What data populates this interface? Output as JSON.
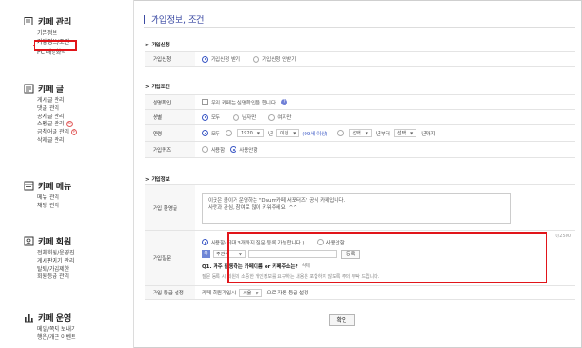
{
  "sidebar": {
    "sections": [
      {
        "title": "카페 관리",
        "icon": "document-icon",
        "items": [
          {
            "label": "기본정보"
          },
          {
            "label": "가입정보/조건",
            "active": true
          },
          {
            "label": "PC 배경화막"
          }
        ]
      },
      {
        "title": "카페 글",
        "icon": "list-icon",
        "items": [
          {
            "label": "게시글 관리"
          },
          {
            "label": "댓글 관리"
          },
          {
            "label": "공지글 관리"
          },
          {
            "label": "스팸글 관리",
            "badge": "N"
          },
          {
            "label": "금칙어글 관리",
            "badge": "N"
          },
          {
            "label": "삭제글 관리"
          }
        ]
      },
      {
        "title": "카페 메뉴",
        "icon": "menu-icon",
        "items": [
          {
            "label": "메뉴 관리"
          },
          {
            "label": "채팅 관리"
          }
        ]
      },
      {
        "title": "카페 회원",
        "icon": "members-icon",
        "items": [
          {
            "label": "전체회원/운영진"
          },
          {
            "label": "게시판지기 관리"
          },
          {
            "label": "탈퇴/가입제한"
          },
          {
            "label": "회원등급 관리"
          }
        ]
      },
      {
        "title": "카페 운영",
        "icon": "chart-icon",
        "items": [
          {
            "label": "메일/쪽지 보내기"
          },
          {
            "label": "행운/개근 이벤트"
          }
        ]
      }
    ]
  },
  "main": {
    "title": "가입정보, 조건",
    "group_join_method": {
      "title": "가입신청",
      "row_label": "가입신청",
      "options": [
        "가입신청 받기",
        "가입신청 안받기"
      ]
    },
    "group_join_condition": {
      "title": "가입조건",
      "verify_label": "실명확인",
      "verify_text": "우리 카페는 실명확인을 합니다.",
      "gender_label": "성별",
      "gender_options": [
        "모두",
        "남자만",
        "여자만"
      ],
      "age_label": "연령",
      "age_all": "모두",
      "age_year": "1920",
      "age_year_unit": "년",
      "age_before": "이전",
      "age_note": "(99세 이상)",
      "age_select1": "선택",
      "age_from": "년부터",
      "age_select2": "선택",
      "age_to": "년까지",
      "quiz_label": "가입퀴즈",
      "quiz_options": [
        "사용함",
        "사용안함"
      ]
    },
    "group_join_info": {
      "title": "가입정보",
      "greeting_label": "가입 환영글",
      "greeting_text_line1": "이곳은 콤이가 운영하는 \"Daum카페 서포터즈\" 공식 카페입니다.",
      "greeting_text_line2": "사랑과 관심, 참여로 많이 키워주세요! ^^",
      "greeting_counter": "0/2500",
      "question_label": "가입질문",
      "question_use": "사용함(최대 3개까지 질문 등록 가능합니다.)",
      "question_nouse": "사용안함",
      "question_type_tag": "Q",
      "question_type": "주관식",
      "register_button": "등록",
      "question_text": "Q1. 자주 활동하는 카페이름 or 카페주소는?",
      "question_delete": "삭제",
      "question_warning": "질문 등록 시 회원의 소중한 개인정보를 요구하는 내용은 포함하지 않도록 주의 부탁 드립니다.",
      "grade_label": "가입 등급 설정",
      "grade_prefix": "카페 회원가입시",
      "grade_value": "씨읋",
      "grade_suffix": "으로 자동 등급 설정"
    },
    "confirm_button": "확인"
  },
  "colors": {
    "accent": "#3b4aa3",
    "highlight_red": "#e1151a"
  }
}
